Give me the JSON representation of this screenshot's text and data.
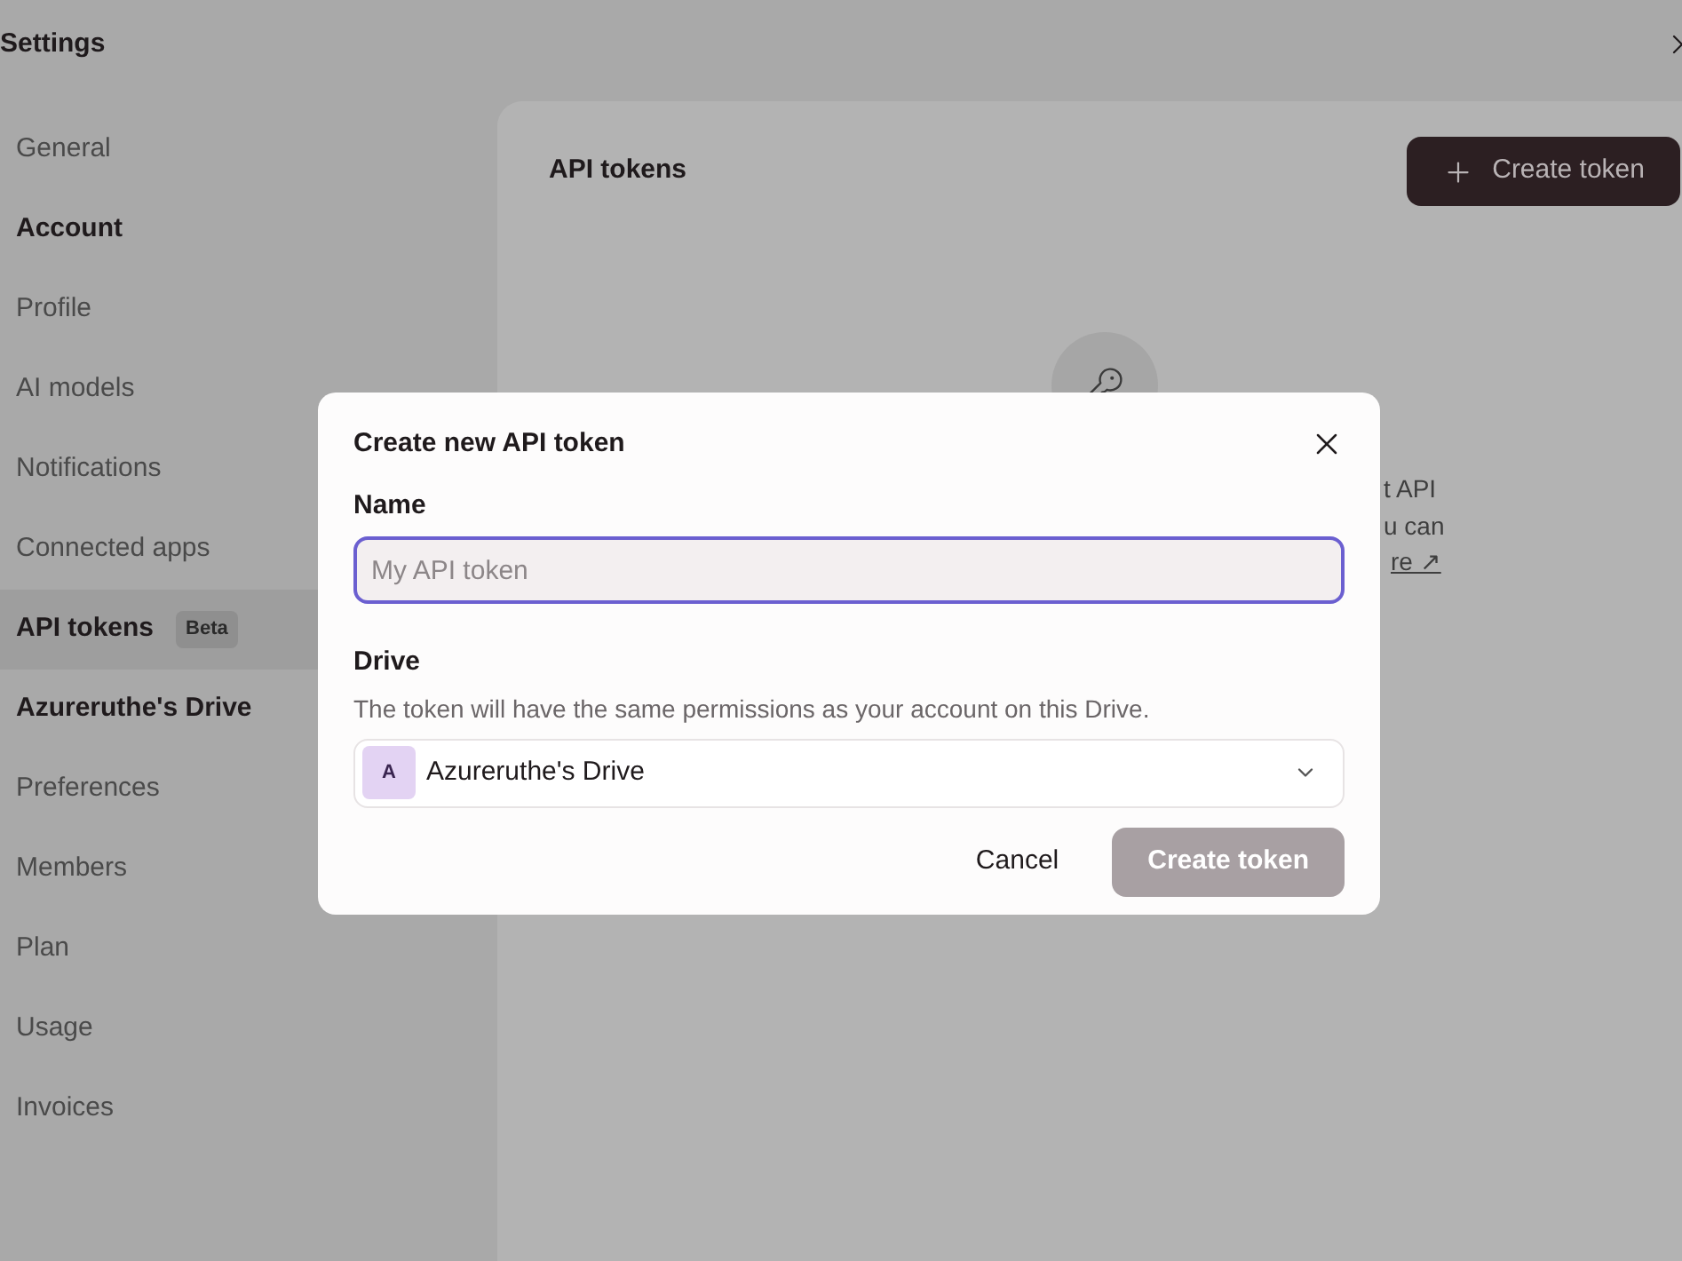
{
  "window": {
    "title": "Settings"
  },
  "sidebar": {
    "items": [
      {
        "kind": "item",
        "label": "General",
        "selected": false
      },
      {
        "kind": "heading",
        "label": "Account"
      },
      {
        "kind": "item",
        "label": "Profile",
        "selected": false
      },
      {
        "kind": "item",
        "label": "AI models",
        "selected": false
      },
      {
        "kind": "item",
        "label": "Notifications",
        "selected": false
      },
      {
        "kind": "item",
        "label": "Connected apps",
        "selected": false
      },
      {
        "kind": "item",
        "label": "API tokens",
        "selected": true,
        "badge": "Beta"
      },
      {
        "kind": "heading",
        "label": "Azureruthe's Drive"
      },
      {
        "kind": "item",
        "label": "Preferences",
        "selected": false
      },
      {
        "kind": "item",
        "label": "Members",
        "selected": false
      },
      {
        "kind": "item",
        "label": "Plan",
        "selected": false
      },
      {
        "kind": "item",
        "label": "Usage",
        "selected": false
      },
      {
        "kind": "item",
        "label": "Invoices",
        "selected": false
      }
    ]
  },
  "panel": {
    "title": "API tokens",
    "create_button": "Create token",
    "hidden_text_lines": [
      "t API",
      "u can"
    ],
    "hidden_link": "re ↗"
  },
  "dialog": {
    "title": "Create new API token",
    "name_field": {
      "label": "Name",
      "placeholder": "My API token"
    },
    "drive_field": {
      "label": "Drive",
      "hint": "The token will have the same permissions as your account on this Drive.",
      "avatar": "A",
      "value": "Azureruthe's Drive"
    },
    "buttons": [
      {
        "kind": "secondary",
        "label": "Cancel",
        "disabled": false
      },
      {
        "kind": "primary",
        "label": "Create token",
        "disabled": true
      }
    ]
  }
}
